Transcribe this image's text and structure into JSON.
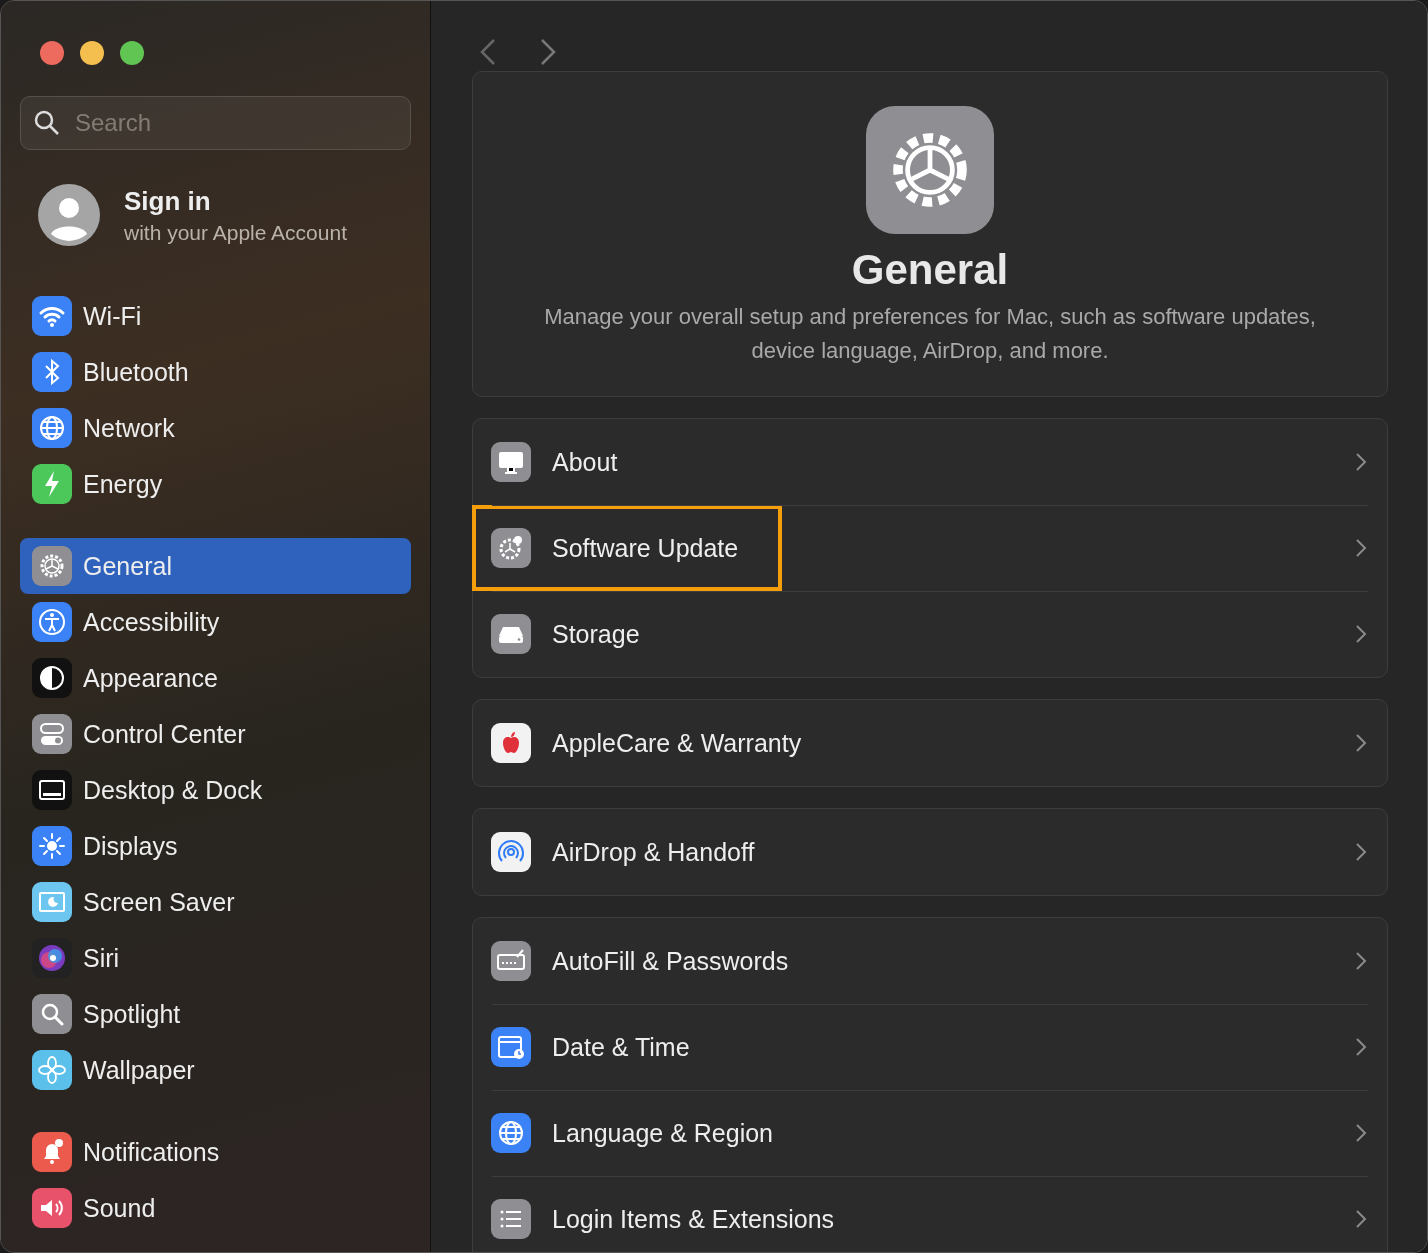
{
  "search": {
    "placeholder": "Search"
  },
  "account": {
    "title": "Sign in",
    "subtitle": "with your Apple Account"
  },
  "sidebar": {
    "groups": [
      {
        "items": [
          {
            "label": "Wi-Fi",
            "selected": false
          },
          {
            "label": "Bluetooth",
            "selected": false
          },
          {
            "label": "Network",
            "selected": false
          },
          {
            "label": "Energy",
            "selected": false
          }
        ]
      },
      {
        "items": [
          {
            "label": "General",
            "selected": true
          },
          {
            "label": "Accessibility",
            "selected": false
          },
          {
            "label": "Appearance",
            "selected": false
          },
          {
            "label": "Control Center",
            "selected": false
          },
          {
            "label": "Desktop & Dock",
            "selected": false
          },
          {
            "label": "Displays",
            "selected": false
          },
          {
            "label": "Screen Saver",
            "selected": false
          },
          {
            "label": "Siri",
            "selected": false
          },
          {
            "label": "Spotlight",
            "selected": false
          },
          {
            "label": "Wallpaper",
            "selected": false
          }
        ]
      },
      {
        "items": [
          {
            "label": "Notifications",
            "selected": false
          },
          {
            "label": "Sound",
            "selected": false
          }
        ]
      }
    ]
  },
  "header": {
    "title": "General",
    "description": "Manage your overall setup and preferences for Mac, such as software updates, device language, AirDrop, and more."
  },
  "groups": [
    {
      "rows": [
        {
          "label": "About",
          "highlighted": false
        },
        {
          "label": "Software Update",
          "highlighted": true
        },
        {
          "label": "Storage",
          "highlighted": false
        }
      ]
    },
    {
      "rows": [
        {
          "label": "AppleCare & Warranty",
          "highlighted": false
        }
      ]
    },
    {
      "rows": [
        {
          "label": "AirDrop & Handoff",
          "highlighted": false
        }
      ]
    },
    {
      "rows": [
        {
          "label": "AutoFill & Passwords",
          "highlighted": false
        },
        {
          "label": "Date & Time",
          "highlighted": false
        },
        {
          "label": "Language & Region",
          "highlighted": false
        },
        {
          "label": "Login Items & Extensions",
          "highlighted": false
        }
      ]
    }
  ]
}
